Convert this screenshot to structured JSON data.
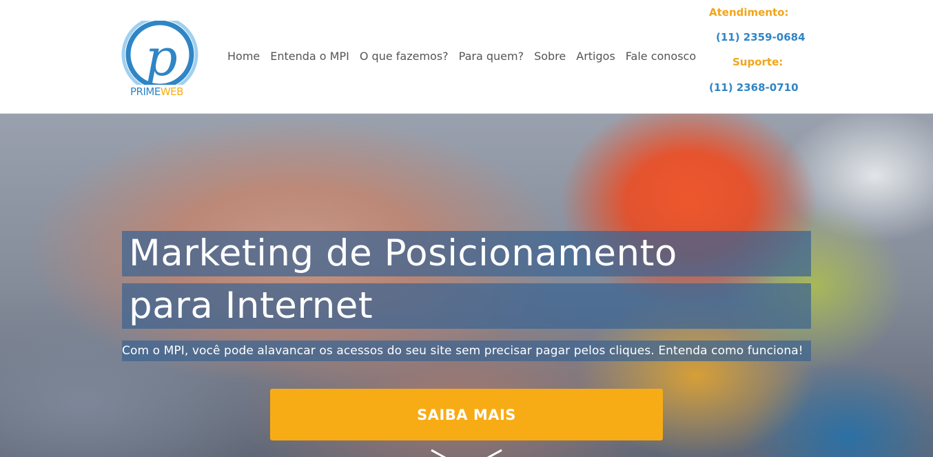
{
  "brand": {
    "logo_letter": "p",
    "logo_text_prime": "PRIME",
    "logo_text_web": "WEB",
    "primary_color": "#2f85c5",
    "accent_color": "#f7ac16"
  },
  "nav": {
    "items": [
      {
        "label": "Home"
      },
      {
        "label": "Entenda o MPI"
      },
      {
        "label": "O que fazemos?"
      },
      {
        "label": "Para quem?"
      },
      {
        "label": "Sobre"
      },
      {
        "label": "Artigos"
      },
      {
        "label": "Fale conosco"
      }
    ]
  },
  "contact": {
    "attendance_label": "Atendimento:",
    "attendance_phone": "(11) 2359-0684",
    "support_label": "Suporte:",
    "support_phone": "(11) 2368-0710"
  },
  "hero": {
    "title_line1": "Marketing de Posicionamento",
    "title_line2": "para Internet",
    "subtitle": "Com o MPI, você pode alavancar os acessos do seu site sem precisar pagar pelos cliques. Entenda como funciona!",
    "cta_label": "SAIBA MAIS",
    "scroll_icon": "chevron-down-icon"
  }
}
